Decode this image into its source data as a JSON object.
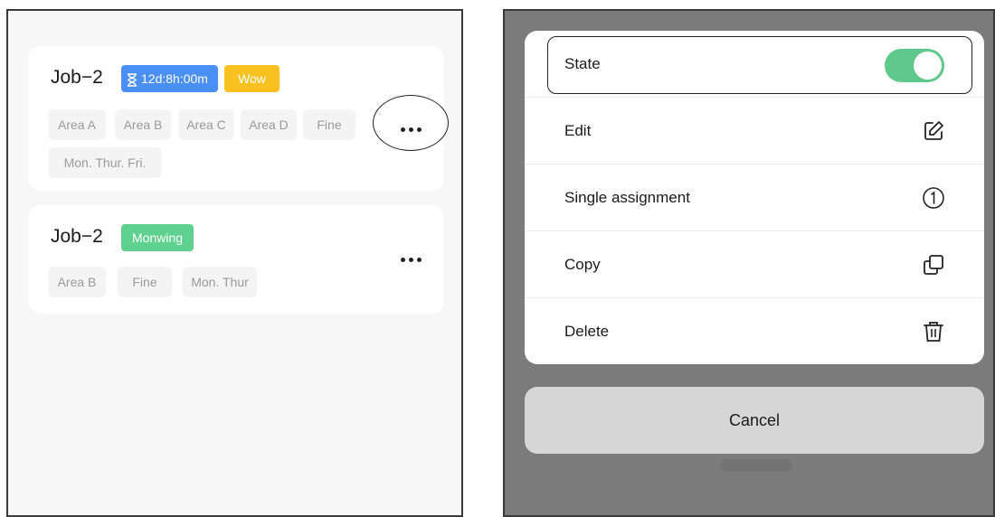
{
  "cards": [
    {
      "title": "Job−2",
      "timer": "12d:8h:00m",
      "badge": "Wow",
      "tags": [
        "Area A",
        "Area B",
        "Area C",
        "Area D",
        "Fine",
        "Mon. Thur. Fri."
      ]
    },
    {
      "title": "Job−2",
      "badge": "Monwing",
      "tags": [
        "Area B",
        "Fine",
        "Mon. Thur"
      ]
    }
  ],
  "sheet": {
    "state_label": "State",
    "state_on": true,
    "edit_label": "Edit",
    "single_assignment_label": "Single assignment",
    "copy_label": "Copy",
    "delete_label": "Delete",
    "cancel_label": "Cancel"
  },
  "icons": {
    "timer": "hourglass-icon",
    "more": "more-dots-icon",
    "edit": "edit-pencil-icon",
    "single": "circled-one-icon",
    "copy": "copy-icon",
    "delete": "trash-icon"
  },
  "colors": {
    "timer_badge": "#4a8ff5",
    "wow_badge": "#f9c11f",
    "monwing_badge": "#5fd18f",
    "toggle_on": "#5ec98a",
    "overlay": "#7b7b7b"
  }
}
